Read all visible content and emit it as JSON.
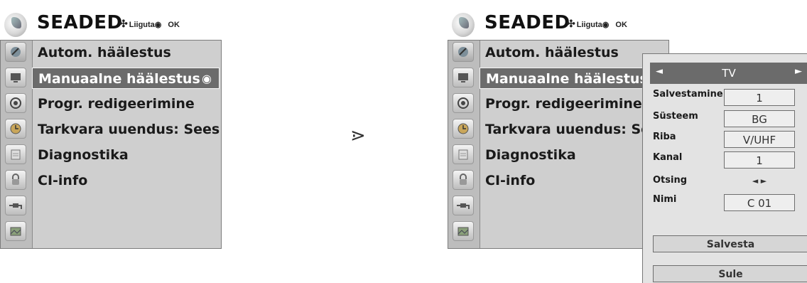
{
  "menu_header": {
    "title": "SEADED",
    "move_hint": "Liiguta",
    "ok_hint": "OK",
    "move_icon": "four-way-arrow-icon",
    "ok_icon": "ok-circle-icon"
  },
  "left_menu": {
    "items": [
      {
        "label": "Autom. häälestus",
        "selected": false
      },
      {
        "label": "Manuaalne häälestus",
        "selected": true,
        "indicator_icon": "target-icon"
      },
      {
        "label": "Progr. redigeerimine",
        "selected": false
      },
      {
        "label": "Tarkvara uuendus: Sees",
        "selected": false
      },
      {
        "label": "Diagnostika",
        "selected": false
      },
      {
        "label": "CI-info",
        "selected": false
      }
    ]
  },
  "right_menu": {
    "items": [
      {
        "label": "Autom. häälestus",
        "selected": false
      },
      {
        "label": "Manuaalne häälestus",
        "selected": true
      },
      {
        "label": "Progr. redigeerimine",
        "selected": false
      },
      {
        "label": "Tarkvara uuendus: Sees",
        "selected": false
      },
      {
        "label": "Diagnostika",
        "selected": false
      },
      {
        "label": "CI-info",
        "selected": false
      }
    ]
  },
  "sidebar_icons": [
    "satellite-dish-icon",
    "tv-screen-icon",
    "speaker-icon",
    "clock-icon",
    "calendar-icon",
    "lock-icon",
    "cable-plug-icon",
    "photo-icon"
  ],
  "separator_glyph": "⋗",
  "popup": {
    "source": "TV",
    "left_arrow": "◄",
    "right_arrow": "►",
    "rows": [
      {
        "label": "Salvestamine",
        "value": "1"
      },
      {
        "label": "Süsteem",
        "value": "BG"
      },
      {
        "label": "Riba",
        "value": "V/UHF"
      },
      {
        "label": "Kanal",
        "value": "1"
      },
      {
        "label": "Otsing",
        "value": "◄ ►"
      },
      {
        "label": "Nimi",
        "value": "C 01"
      }
    ],
    "save_button": "Salvesta",
    "close_button": "Sule"
  },
  "colors": {
    "panel": "#cfcfcf",
    "sidebar": "#bdbdbd",
    "selected": "#6b6b6b",
    "popup": "#e3e3e3"
  }
}
